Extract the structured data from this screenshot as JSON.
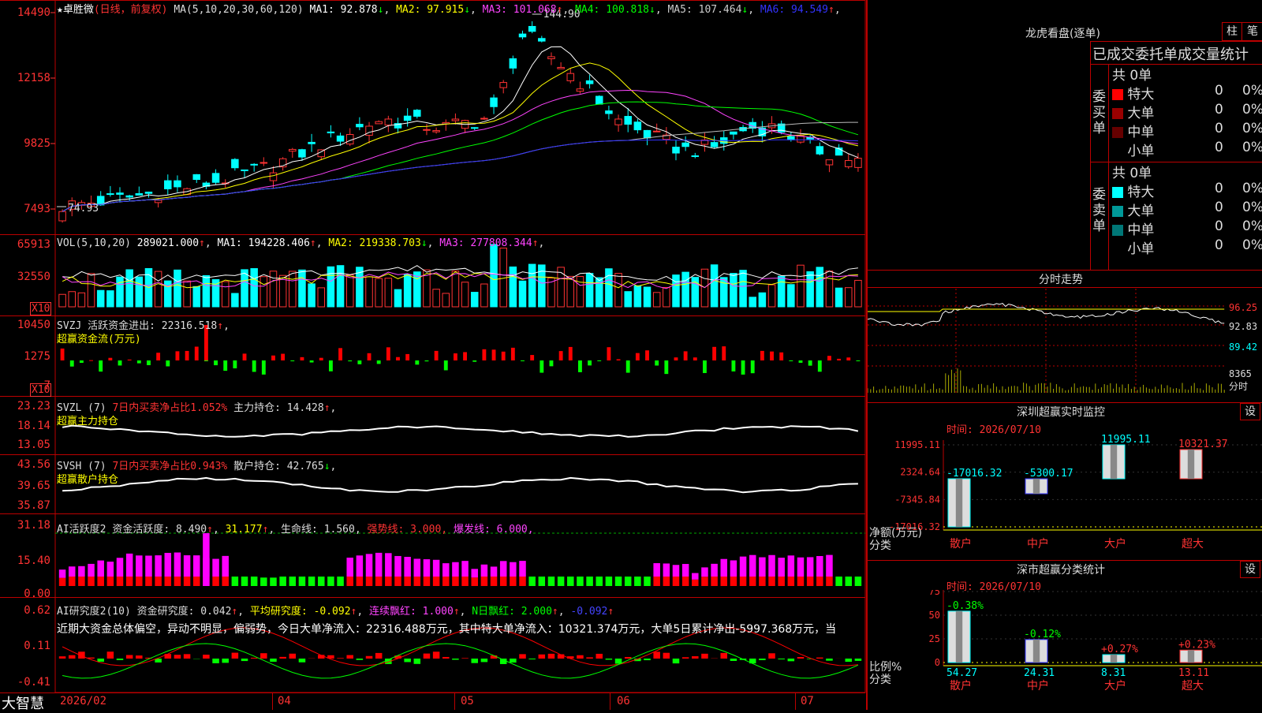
{
  "main": {
    "star_name": "★卓胜微",
    "period": "(日线，前复权)",
    "ma_spec": "MA(5,10,20,30,60,120)",
    "ma": [
      {
        "label": "MA1:",
        "value": "92.878",
        "arrow": "↓",
        "color": "#ffffff"
      },
      {
        "label": "MA2:",
        "value": "97.915",
        "arrow": "↓",
        "color": "#ffff00"
      },
      {
        "label": "MA3:",
        "value": "101.068",
        "arrow": "↑",
        "color": "#ff44ff"
      },
      {
        "label": "MA4:",
        "value": "100.818",
        "arrow": "↓",
        "color": "#00ff00"
      },
      {
        "label": "MA5:",
        "value": "107.464",
        "arrow": "↓",
        "color": "#cccccc"
      },
      {
        "label": "MA6:",
        "value": "94.549",
        "arrow": "↑",
        "color": "#3333ff"
      }
    ],
    "high_label": "144.90",
    "low_label": "74.93",
    "yticks": [
      "14490",
      "12158",
      "9825",
      "7493"
    ]
  },
  "vol": {
    "title": "VOL(5,10,20)",
    "value": "289021.000",
    "ma": [
      {
        "label": "MA1:",
        "value": "194228.406",
        "arrow": "↑",
        "color": "#ffffff"
      },
      {
        "label": "MA2:",
        "value": "219338.703",
        "arrow": "↓",
        "color": "#ffff00"
      },
      {
        "label": "MA3:",
        "value": "277808.344",
        "arrow": "↑",
        "color": "#ff44ff"
      }
    ],
    "yticks": [
      "65913",
      "32550"
    ],
    "unit": "X10"
  },
  "svzj": {
    "title": "SVZJ",
    "label": "活跃资金进出:",
    "value": "22316.518",
    "arrow": "↑",
    "sub": "超赢资金流(万元)",
    "yticks": [
      "10450",
      "1275",
      "-7"
    ],
    "unit": "X10"
  },
  "svzl": {
    "title": "SVZL (7)",
    "label1": "7日内买卖净占比1.052%",
    "label2": "主力持仓:",
    "value": "14.428",
    "arrow": "↑",
    "sub": "超赢主力持仓",
    "yticks": [
      "23.23",
      "18.14",
      "13.05"
    ]
  },
  "svsh": {
    "title": "SVSH (7)",
    "label1": "7日内买卖净占比0.943%",
    "label2": "散户持仓:",
    "value": "42.765",
    "arrow": "↓",
    "sub": "超赢散户持仓",
    "yticks": [
      "43.56",
      "39.65",
      "35.87"
    ]
  },
  "ai_active": {
    "title": "AI活跃度2",
    "label": "资金活跃度:",
    "value": "8.490",
    "v2": "31.177",
    "life": "生命线:",
    "life_v": "1.560",
    "strong": "强势线:",
    "strong_v": "3.000",
    "burst": "爆发线:",
    "burst_v": "6.000",
    "yticks": [
      "31.18",
      "15.40",
      "0.00"
    ]
  },
  "ai_research": {
    "title": "AI研究度2(10)",
    "label": "资金研究度:",
    "value": "0.042",
    "avg": "平均研究度:",
    "avg_v": "-0.092",
    "cont": "连续飘红:",
    "cont_v": "1.000",
    "nday": "N日飘红:",
    "nday_v": "2.000",
    "last": "-0.092",
    "comment": "近期大资金总体偏空，异动不明显，偏弱势，今日大单净流入：22316.488万元，其中特大单净流入：10321.374万元，大单5日累计净出-5997.368万元，当",
    "yticks": [
      "0.62",
      "0.11",
      "-0.41"
    ]
  },
  "xaxis": {
    "brand": "大智慧",
    "labels": [
      "2026/02",
      "04",
      "05",
      "06",
      "07"
    ]
  },
  "dragon": {
    "title": "龙虎看盘(逐单)",
    "btn1": "柱",
    "btn2": "笔",
    "header": "已成交委托单成交量统计",
    "buy": {
      "side": "委买单",
      "total": "共 0单",
      "rows": [
        {
          "name": "特大",
          "qty": "0",
          "pct": "0%",
          "color": "#ff0000"
        },
        {
          "name": "大单",
          "qty": "0",
          "pct": "0%",
          "color": "#990000"
        },
        {
          "name": "中单",
          "qty": "0",
          "pct": "0%",
          "color": "#660000"
        },
        {
          "name": "小单",
          "qty": "0",
          "pct": "0%",
          "color": "#000000"
        }
      ]
    },
    "sell": {
      "side": "委卖单",
      "total": "共 0单",
      "rows": [
        {
          "name": "特大",
          "qty": "0",
          "pct": "0%",
          "color": "#00ffff"
        },
        {
          "name": "大单",
          "qty": "0",
          "pct": "0%",
          "color": "#009999"
        },
        {
          "name": "中单",
          "qty": "0",
          "pct": "0%",
          "color": "#007777"
        },
        {
          "name": "小单",
          "qty": "0",
          "pct": "0%",
          "color": "#000000"
        }
      ]
    }
  },
  "intraday": {
    "title": "分时走势",
    "yticks": [
      "96.25",
      "92.83",
      "89.42"
    ],
    "vol_label": "8365",
    "vol_unit": "分时"
  },
  "sz_monitor": {
    "title": "深圳超赢实时监控",
    "btn": "设",
    "time": "时间: 2026/07/10",
    "yticks": [
      "11995.11",
      "2324.64",
      "-7345.84",
      "-17016.32"
    ],
    "ylabel1": "净额(万元)",
    "ylabel2": "分类",
    "chart_data": {
      "type": "bar",
      "categories": [
        "散户",
        "中户",
        "大户",
        "超大"
      ],
      "values": [
        -17016.32,
        -5300.17,
        11995.11,
        10321.37
      ],
      "value_labels": [
        "-17016.32",
        "-5300.17",
        "11995.11",
        "10321.37"
      ],
      "ylim": [
        -17016.32,
        11995.11
      ]
    }
  },
  "sz_class": {
    "title": "深市超赢分类统计",
    "btn": "设",
    "time": "时间: 2026/07/10",
    "yticks": [
      "75",
      "50",
      "25",
      "0"
    ],
    "ylabel1": "比例%",
    "ylabel2": "分类",
    "chart_data": {
      "type": "bar",
      "categories": [
        "散户",
        "中户",
        "大户",
        "超大"
      ],
      "values": [
        54.27,
        24.31,
        8.31,
        13.11
      ],
      "value_labels": [
        "54.27",
        "24.31",
        "8.31",
        "13.11"
      ],
      "changes": [
        "-0.38%",
        "-0.12%",
        "+0.27%",
        "+0.23%"
      ],
      "ylim": [
        0,
        75
      ]
    }
  }
}
